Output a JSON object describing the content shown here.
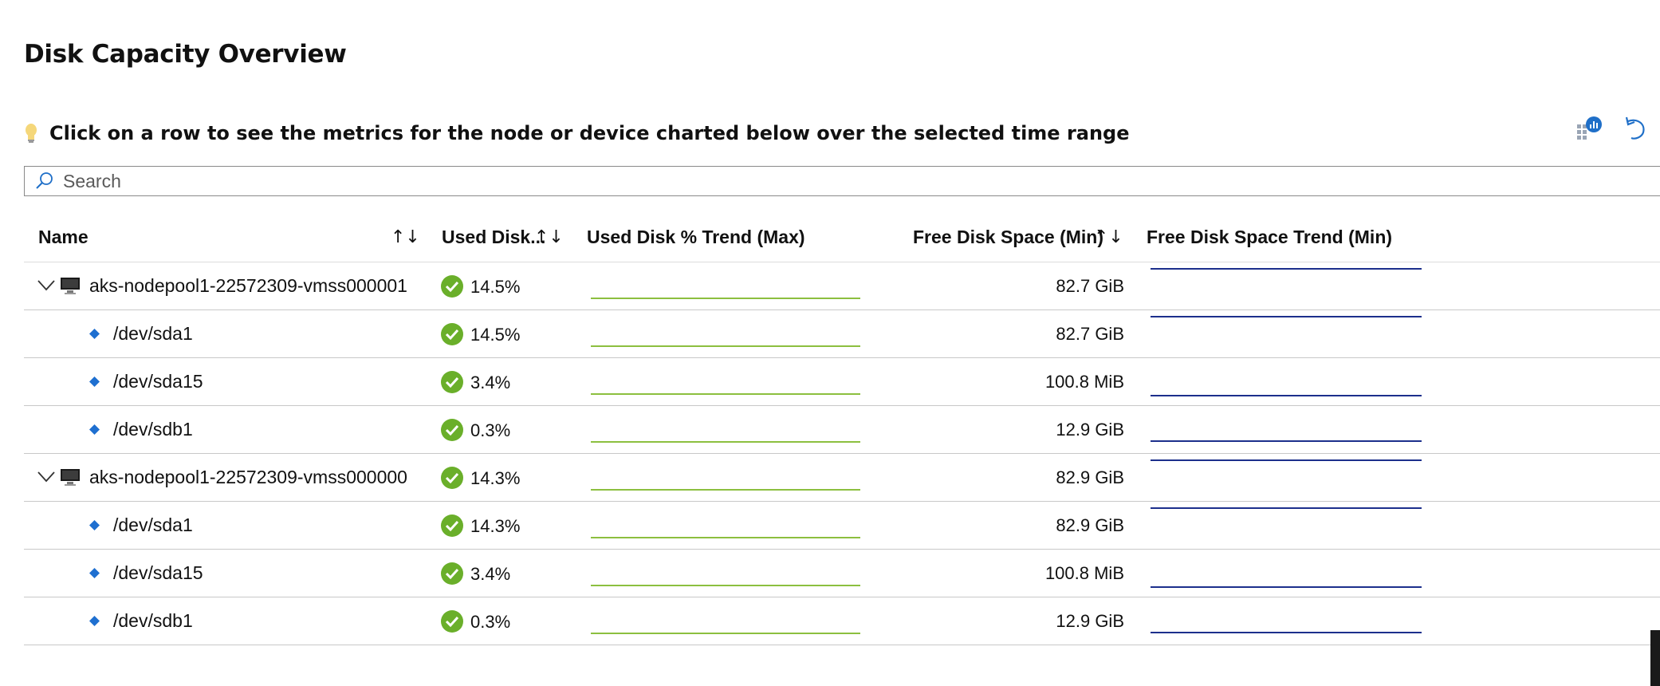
{
  "title": "Disk Capacity Overview",
  "hint": {
    "icon": "lightbulb-icon",
    "text": "Click on a row to see the metrics for the node or device charted below over the selected time range"
  },
  "toolbar": {
    "icons": [
      "workbook-chart-icon",
      "undo-icon"
    ]
  },
  "search": {
    "placeholder": "Search",
    "value": ""
  },
  "columns": {
    "name": "Name",
    "used": "Used Disk...",
    "used_trend": "Used Disk % Trend (Max)",
    "free": "Free Disk Space (Min)",
    "free_trend": "Free Disk Space Trend (Min)",
    "sort_glyph": "↑↓"
  },
  "colors": {
    "ok": "#6aaf2a",
    "trend_used": "#8cbf3f",
    "trend_free": "#1c2f8c",
    "device": "#1e6fd0"
  },
  "rows": [
    {
      "type": "node",
      "name": "aks-nodepool1-22572309-vmss000001",
      "used": "14.5%",
      "free": "82.7 GiB"
    },
    {
      "type": "device",
      "name": "/dev/sda1",
      "used": "14.5%",
      "free": "82.7 GiB"
    },
    {
      "type": "device",
      "name": "/dev/sda15",
      "used": "3.4%",
      "free": "100.8 MiB"
    },
    {
      "type": "device",
      "name": "/dev/sdb1",
      "used": "0.3%",
      "free": "12.9 GiB"
    },
    {
      "type": "node",
      "name": "aks-nodepool1-22572309-vmss000000",
      "used": "14.3%",
      "free": "82.9 GiB"
    },
    {
      "type": "device",
      "name": "/dev/sda1",
      "used": "14.3%",
      "free": "82.9 GiB"
    },
    {
      "type": "device",
      "name": "/dev/sda15",
      "used": "3.4%",
      "free": "100.8 MiB"
    },
    {
      "type": "device",
      "name": "/dev/sdb1",
      "used": "0.3%",
      "free": "12.9 GiB"
    }
  ]
}
